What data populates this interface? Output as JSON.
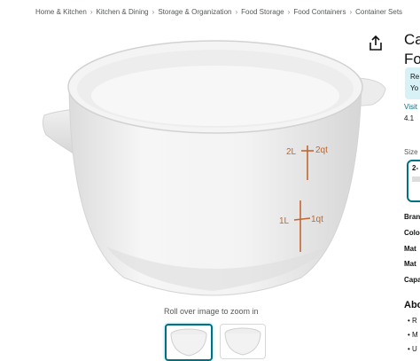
{
  "breadcrumb": [
    "Home & Kitchen",
    "Kitchen & Dining",
    "Storage & Organization",
    "Food Storage",
    "Food Containers",
    "Container Sets"
  ],
  "product_image": {
    "marks": {
      "upper_left": "2L",
      "upper_right": "2qt",
      "lower_left": "1L",
      "lower_right": "1qt"
    },
    "zoom_hint": "Roll over image to zoom in"
  },
  "product": {
    "title_line1": "Ca",
    "title_line2": "Fo",
    "returns_line1": "Re",
    "returns_line2": "Yo",
    "visit": "Visit",
    "rating": "4.1",
    "size_label": "Size",
    "size_option": "2-",
    "specs": [
      "Bran",
      "Colo",
      "Mat",
      "Mat",
      "Capa"
    ],
    "about_heading": "Abo",
    "bullets": [
      "R",
      "M",
      "U"
    ]
  },
  "colors": {
    "accent": "#007185",
    "mark": "#c0662f"
  }
}
